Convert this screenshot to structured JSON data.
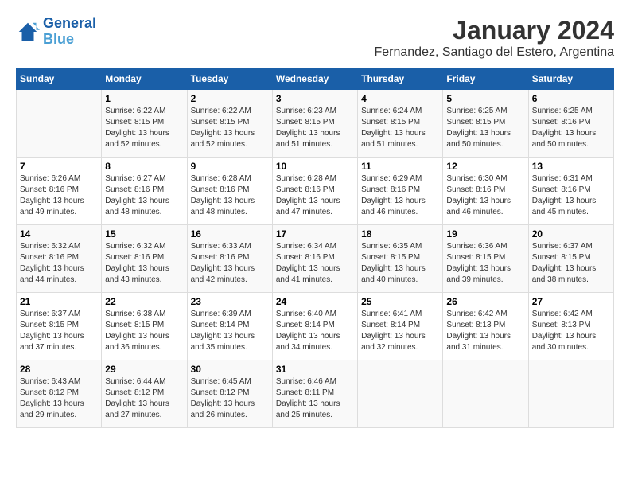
{
  "header": {
    "logo_line1": "General",
    "logo_line2": "Blue",
    "month": "January 2024",
    "location": "Fernandez, Santiago del Estero, Argentina"
  },
  "days_of_week": [
    "Sunday",
    "Monday",
    "Tuesday",
    "Wednesday",
    "Thursday",
    "Friday",
    "Saturday"
  ],
  "weeks": [
    [
      {
        "day": "",
        "sunrise": "",
        "sunset": "",
        "daylight": ""
      },
      {
        "day": "1",
        "sunrise": "6:22 AM",
        "sunset": "8:15 PM",
        "hours": "13 hours",
        "minutes": "and 52 minutes."
      },
      {
        "day": "2",
        "sunrise": "6:22 AM",
        "sunset": "8:15 PM",
        "hours": "13 hours",
        "minutes": "and 52 minutes."
      },
      {
        "day": "3",
        "sunrise": "6:23 AM",
        "sunset": "8:15 PM",
        "hours": "13 hours",
        "minutes": "and 51 minutes."
      },
      {
        "day": "4",
        "sunrise": "6:24 AM",
        "sunset": "8:15 PM",
        "hours": "13 hours",
        "minutes": "and 51 minutes."
      },
      {
        "day": "5",
        "sunrise": "6:25 AM",
        "sunset": "8:15 PM",
        "hours": "13 hours",
        "minutes": "and 50 minutes."
      },
      {
        "day": "6",
        "sunrise": "6:25 AM",
        "sunset": "8:16 PM",
        "hours": "13 hours",
        "minutes": "and 50 minutes."
      }
    ],
    [
      {
        "day": "7",
        "sunrise": "6:26 AM",
        "sunset": "8:16 PM",
        "hours": "13 hours",
        "minutes": "and 49 minutes."
      },
      {
        "day": "8",
        "sunrise": "6:27 AM",
        "sunset": "8:16 PM",
        "hours": "13 hours",
        "minutes": "and 48 minutes."
      },
      {
        "day": "9",
        "sunrise": "6:28 AM",
        "sunset": "8:16 PM",
        "hours": "13 hours",
        "minutes": "and 48 minutes."
      },
      {
        "day": "10",
        "sunrise": "6:28 AM",
        "sunset": "8:16 PM",
        "hours": "13 hours",
        "minutes": "and 47 minutes."
      },
      {
        "day": "11",
        "sunrise": "6:29 AM",
        "sunset": "8:16 PM",
        "hours": "13 hours",
        "minutes": "and 46 minutes."
      },
      {
        "day": "12",
        "sunrise": "6:30 AM",
        "sunset": "8:16 PM",
        "hours": "13 hours",
        "minutes": "and 46 minutes."
      },
      {
        "day": "13",
        "sunrise": "6:31 AM",
        "sunset": "8:16 PM",
        "hours": "13 hours",
        "minutes": "and 45 minutes."
      }
    ],
    [
      {
        "day": "14",
        "sunrise": "6:32 AM",
        "sunset": "8:16 PM",
        "hours": "13 hours",
        "minutes": "and 44 minutes."
      },
      {
        "day": "15",
        "sunrise": "6:32 AM",
        "sunset": "8:16 PM",
        "hours": "13 hours",
        "minutes": "and 43 minutes."
      },
      {
        "day": "16",
        "sunrise": "6:33 AM",
        "sunset": "8:16 PM",
        "hours": "13 hours",
        "minutes": "and 42 minutes."
      },
      {
        "day": "17",
        "sunrise": "6:34 AM",
        "sunset": "8:16 PM",
        "hours": "13 hours",
        "minutes": "and 41 minutes."
      },
      {
        "day": "18",
        "sunrise": "6:35 AM",
        "sunset": "8:15 PM",
        "hours": "13 hours",
        "minutes": "and 40 minutes."
      },
      {
        "day": "19",
        "sunrise": "6:36 AM",
        "sunset": "8:15 PM",
        "hours": "13 hours",
        "minutes": "and 39 minutes."
      },
      {
        "day": "20",
        "sunrise": "6:37 AM",
        "sunset": "8:15 PM",
        "hours": "13 hours",
        "minutes": "and 38 minutes."
      }
    ],
    [
      {
        "day": "21",
        "sunrise": "6:37 AM",
        "sunset": "8:15 PM",
        "hours": "13 hours",
        "minutes": "and 37 minutes."
      },
      {
        "day": "22",
        "sunrise": "6:38 AM",
        "sunset": "8:15 PM",
        "hours": "13 hours",
        "minutes": "and 36 minutes."
      },
      {
        "day": "23",
        "sunrise": "6:39 AM",
        "sunset": "8:14 PM",
        "hours": "13 hours",
        "minutes": "and 35 minutes."
      },
      {
        "day": "24",
        "sunrise": "6:40 AM",
        "sunset": "8:14 PM",
        "hours": "13 hours",
        "minutes": "and 34 minutes."
      },
      {
        "day": "25",
        "sunrise": "6:41 AM",
        "sunset": "8:14 PM",
        "hours": "13 hours",
        "minutes": "and 32 minutes."
      },
      {
        "day": "26",
        "sunrise": "6:42 AM",
        "sunset": "8:13 PM",
        "hours": "13 hours",
        "minutes": "and 31 minutes."
      },
      {
        "day": "27",
        "sunrise": "6:42 AM",
        "sunset": "8:13 PM",
        "hours": "13 hours",
        "minutes": "and 30 minutes."
      }
    ],
    [
      {
        "day": "28",
        "sunrise": "6:43 AM",
        "sunset": "8:12 PM",
        "hours": "13 hours",
        "minutes": "and 29 minutes."
      },
      {
        "day": "29",
        "sunrise": "6:44 AM",
        "sunset": "8:12 PM",
        "hours": "13 hours",
        "minutes": "and 27 minutes."
      },
      {
        "day": "30",
        "sunrise": "6:45 AM",
        "sunset": "8:12 PM",
        "hours": "13 hours",
        "minutes": "and 26 minutes."
      },
      {
        "day": "31",
        "sunrise": "6:46 AM",
        "sunset": "8:11 PM",
        "hours": "13 hours",
        "minutes": "and 25 minutes."
      },
      {
        "day": "",
        "sunrise": "",
        "sunset": "",
        "hours": "",
        "minutes": ""
      },
      {
        "day": "",
        "sunrise": "",
        "sunset": "",
        "hours": "",
        "minutes": ""
      },
      {
        "day": "",
        "sunrise": "",
        "sunset": "",
        "hours": "",
        "minutes": ""
      }
    ]
  ]
}
